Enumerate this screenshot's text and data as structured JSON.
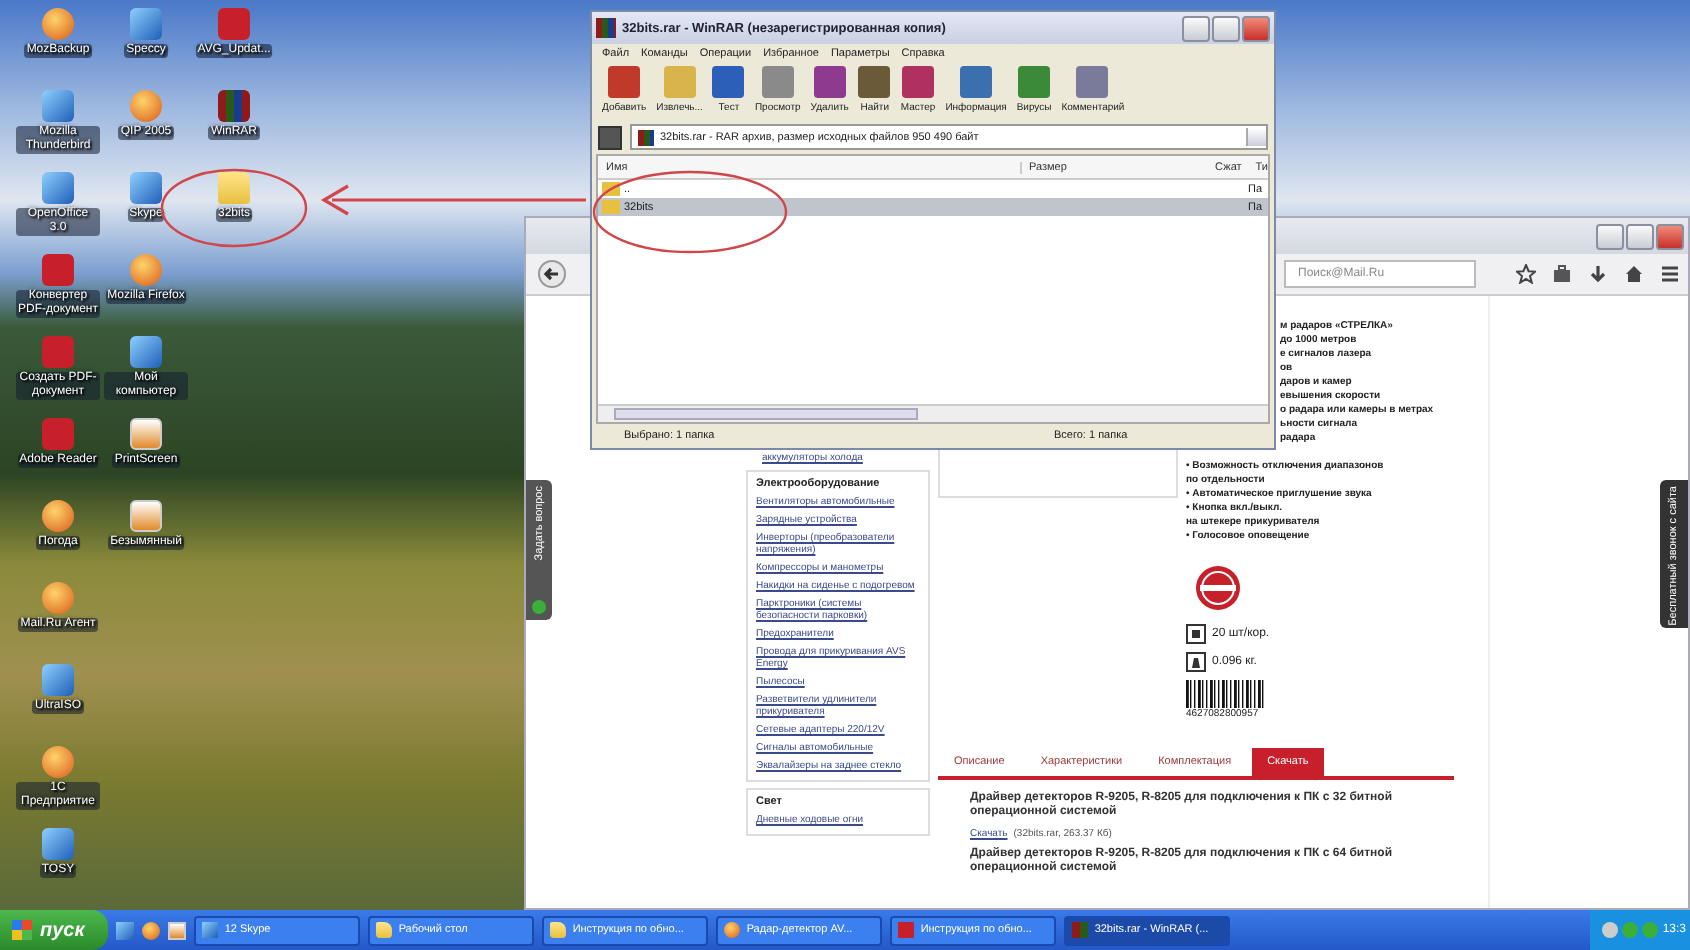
{
  "desktop": {
    "icon_columns": [
      [
        {
          "label": "MozBackup",
          "kind": "app"
        },
        {
          "label": "Mozilla Thunderbird",
          "kind": "web"
        },
        {
          "label": "OpenOffice 3.0",
          "kind": "web"
        },
        {
          "label": "Конвертер PDF-документ",
          "kind": "pdf"
        },
        {
          "label": "Создать PDF-документ",
          "kind": "pdf"
        },
        {
          "label": "Adobe Reader",
          "kind": "pdf"
        },
        {
          "label": "Погода",
          "kind": "app"
        },
        {
          "label": "Mail.Ru Агент",
          "kind": "app"
        },
        {
          "label": "UltraISO",
          "kind": "web"
        },
        {
          "label": "1С Предприятие",
          "kind": "app"
        },
        {
          "label": "TOSY",
          "kind": "web"
        }
      ],
      [
        {
          "label": "Speccy",
          "kind": "web"
        },
        {
          "label": "QIP 2005",
          "kind": "app"
        },
        {
          "label": "Skype",
          "kind": "web"
        },
        {
          "label": "Mozilla Firefox",
          "kind": "app"
        },
        {
          "label": "Мой компьютер",
          "kind": "web"
        },
        {
          "label": "PrintScreen",
          "kind": "doc"
        },
        {
          "label": "Безымянный",
          "kind": "doc"
        }
      ],
      [
        {
          "label": "AVG_Updat...",
          "kind": "pdf"
        },
        {
          "label": "WinRAR",
          "kind": "archive"
        },
        {
          "label": "32bits",
          "kind": "folder"
        }
      ]
    ]
  },
  "winrar": {
    "title": "32bits.rar - WinRAR (незарегистрированная копия)",
    "menu": [
      "Файл",
      "Команды",
      "Операции",
      "Избранное",
      "Параметры",
      "Справка"
    ],
    "toolbar": [
      "Добавить",
      "Извлечь...",
      "Тест",
      "Просмотр",
      "Удалить",
      "Найти",
      "Мастер",
      "Информация",
      "Вирусы",
      "Комментарий"
    ],
    "address": "32bits.rar - RAR архив, размер исходных файлов 950 490 байт",
    "columns": [
      "Имя",
      "Размер",
      "Сжат",
      "Ти"
    ],
    "rows": [
      {
        "name": "..",
        "type": "Па",
        "selected": false
      },
      {
        "name": "32bits",
        "type": "Па",
        "selected": true
      }
    ],
    "status_selected": "Выбрано: 1 папка",
    "status_total": "Всего: 1 папка"
  },
  "browser": {
    "search_placeholder": "Поиск@Mail.Ru",
    "ask_tab": "Задать вопрос",
    "call_tab": "Бесплатный звонок с сайта",
    "sidebar": {
      "top_link": "аккумуляторы холода",
      "sections": [
        {
          "title": "Электрооборудование",
          "links": [
            "Вентиляторы автомобильные",
            "Зарядные устройства",
            "Инверторы (преобразователи напряжения)",
            "Компрессоры и манометры",
            "Накидки на сиденье с подогревом",
            "Парктроники (системы безопасности парковки)",
            "Предохранители",
            "Провода для прикуривания AVS Energy",
            "Пылесосы",
            "Разветвители удлинители прикуривателя",
            "Сетевые адаптеры 220/12V",
            "Сигналы автомобильные",
            "Эквалайзеры на заднее стекло"
          ]
        },
        {
          "title": "Свет",
          "links": [
            "Дневные ходовые огни"
          ]
        }
      ]
    },
    "features": [
      {
        "text": "м радаров «СТРЕЛКА»",
        "kind": "partial"
      },
      {
        "text": "до 1000 метров",
        "kind": "partial"
      },
      {
        "text": "е сигналов лазера",
        "kind": "partial"
      },
      {
        "text": "ов",
        "kind": "partial"
      },
      {
        "text": "даров и камер",
        "kind": "partial"
      },
      {
        "text": "евышения скорости",
        "kind": "partial"
      },
      {
        "text": "о радара или камеры в метрах",
        "kind": "partial"
      },
      {
        "text": "ьности сигнала",
        "kind": "partial"
      },
      {
        "text": "радара",
        "kind": "partial"
      },
      {
        "text": "• Возможность отключения диапазонов",
        "kind": "full"
      },
      {
        "text": "по отдельности",
        "kind": "full"
      },
      {
        "text": "• Автоматическое приглушение звука",
        "kind": "full"
      },
      {
        "text": "• Кнопка вкл./выкл.",
        "kind": "full"
      },
      {
        "text": "на штекере прикуривателя",
        "kind": "full"
      },
      {
        "text": "• Голосовое оповещение",
        "kind": "full"
      }
    ],
    "pack": "20 шт/кор.",
    "weight": "0.096 кг.",
    "barcode": "4627082800957",
    "tabs": [
      {
        "label": "Описание",
        "selected": false
      },
      {
        "label": "Характеристики",
        "selected": false
      },
      {
        "label": "Комплектация",
        "selected": false
      },
      {
        "label": "Скачать",
        "selected": true
      }
    ],
    "downloads": [
      {
        "title": "Драйвер детекторов R-9205, R-8205 для подключения к ПК с 32 битной операционной системой",
        "link": "Скачать",
        "info": "(32bits.rar, 263.37 Кб)"
      },
      {
        "title": "Драйвер детекторов R-9205, R-8205 для подключения к ПК с 64 битной операционной системой"
      }
    ]
  },
  "taskbar": {
    "start": "пуск",
    "tasks": [
      {
        "label": "12 Skype",
        "kind": "web",
        "selected": false
      },
      {
        "label": "Рабочий стол",
        "kind": "folder",
        "selected": false
      },
      {
        "label": "Инструкция по обно...",
        "kind": "folder",
        "selected": false
      },
      {
        "label": "Радар-детектор AV...",
        "kind": "app",
        "selected": false
      },
      {
        "label": "Инструкция по обно...",
        "kind": "pdf",
        "selected": false
      },
      {
        "label": "32bits.rar - WinRAR (...",
        "kind": "archive",
        "selected": true
      }
    ],
    "clock": "13:3"
  }
}
